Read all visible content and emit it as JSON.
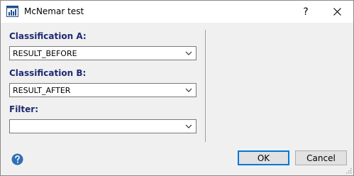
{
  "window": {
    "title": "McNemar test",
    "help_glyph": "?",
    "icon": "chart-table-icon"
  },
  "form": {
    "classification_a": {
      "label": "Classification A:",
      "value": "RESULT_BEFORE"
    },
    "classification_b": {
      "label": "Classification B:",
      "value": "RESULT_AFTER"
    },
    "filter": {
      "label": "Filter:",
      "value": ""
    }
  },
  "buttons": {
    "ok": "OK",
    "cancel": "Cancel"
  },
  "colors": {
    "label": "#1f2a72",
    "help_icon": "#2f6fb3",
    "default_button_border": "#0078d7"
  }
}
